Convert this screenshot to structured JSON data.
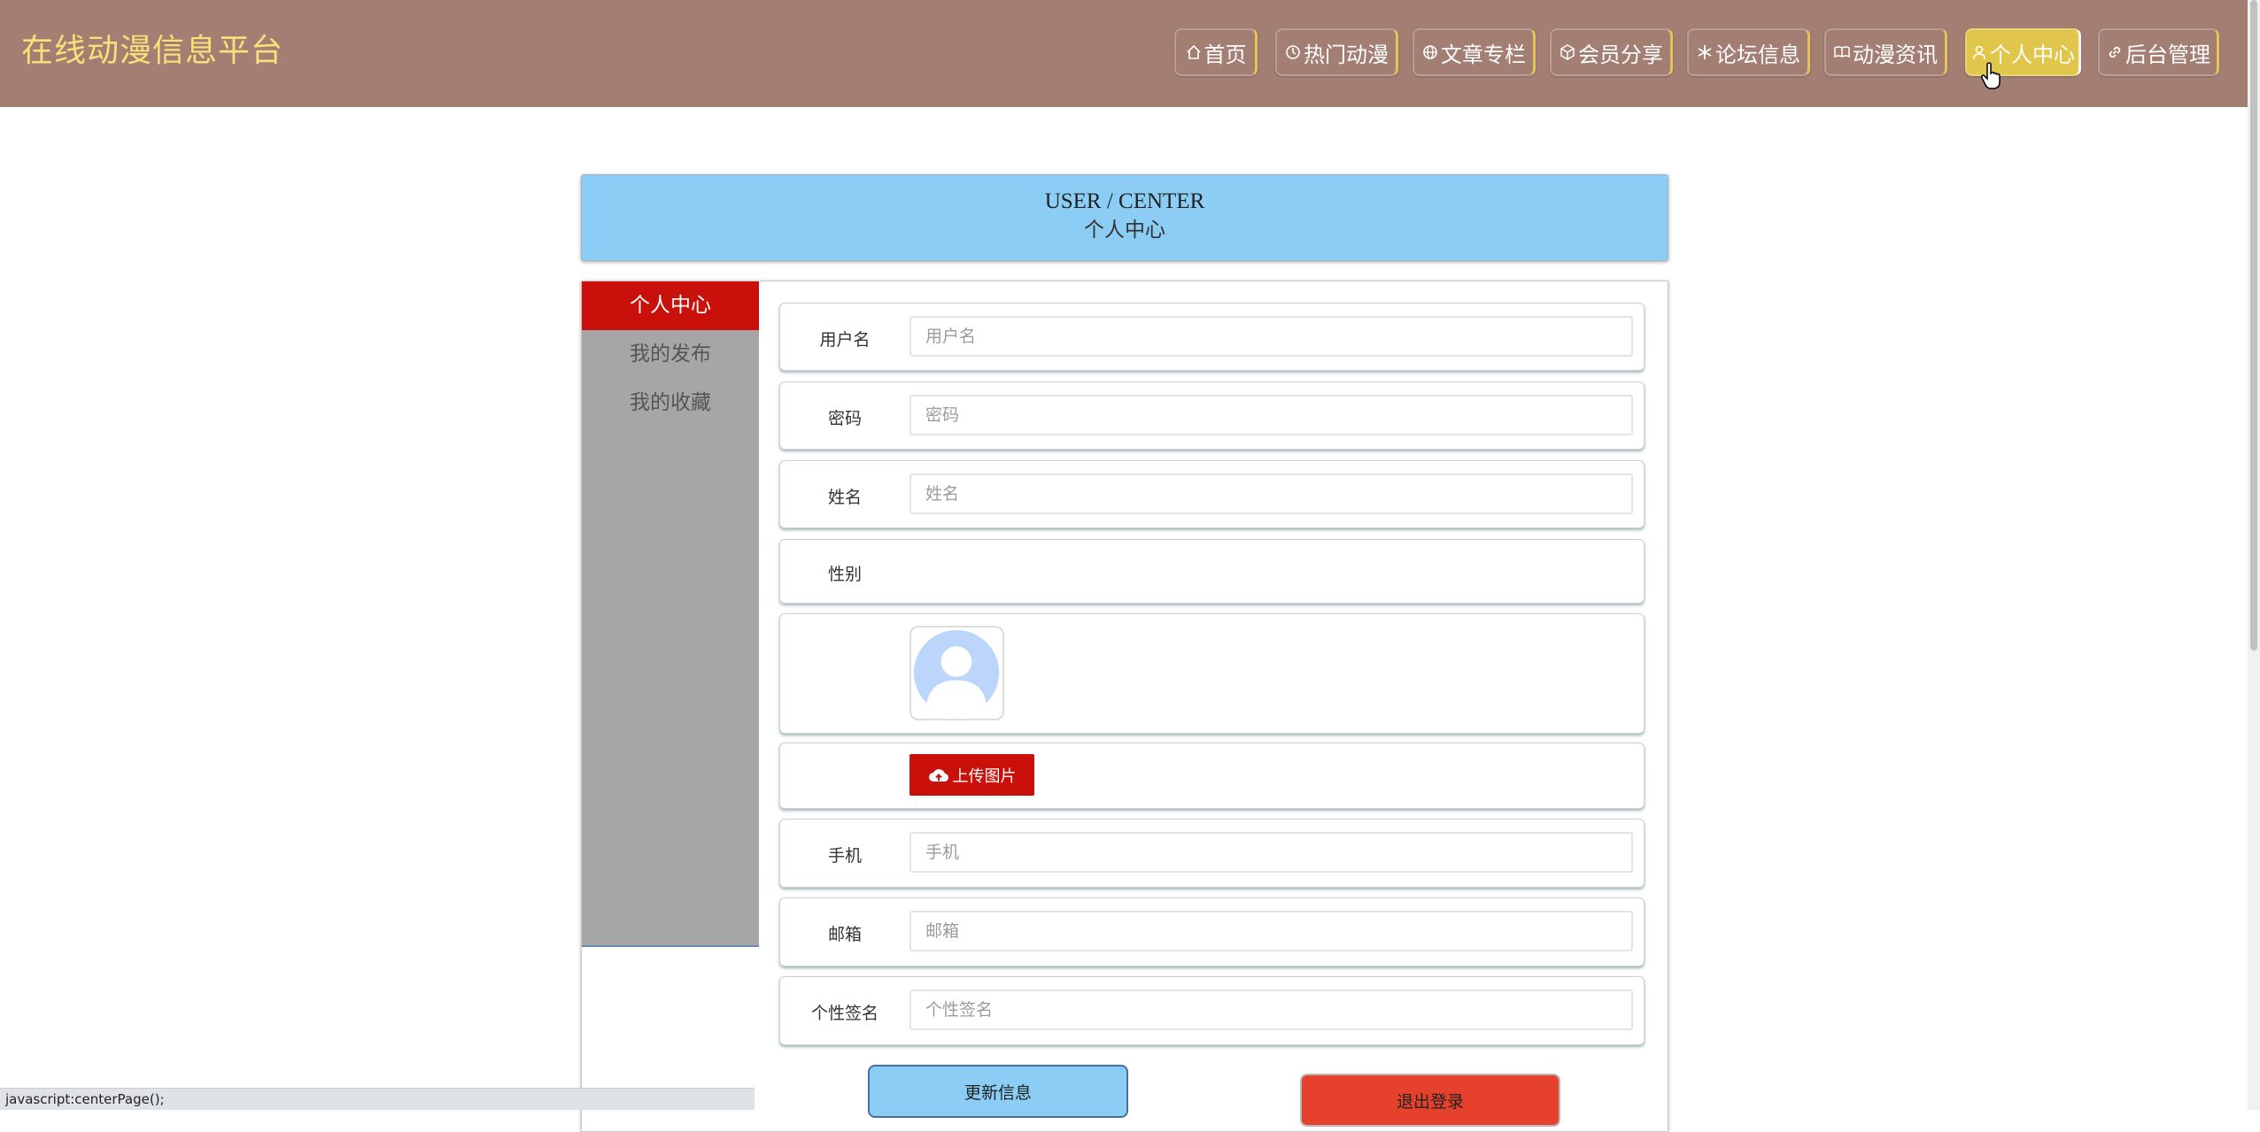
{
  "header": {
    "brand": "在线动漫信息平台",
    "nav": [
      {
        "label": "首页",
        "icon": "home-icon"
      },
      {
        "label": "热门动漫",
        "icon": "clock-icon"
      },
      {
        "label": "文章专栏",
        "icon": "globe-icon"
      },
      {
        "label": "会员分享",
        "icon": "cube-icon"
      },
      {
        "label": "论坛信息",
        "icon": "snowflake-icon"
      },
      {
        "label": "动漫资讯",
        "icon": "book-icon"
      },
      {
        "label": "个人中心",
        "icon": "user-icon",
        "active": true
      },
      {
        "label": "后台管理",
        "icon": "link-icon"
      }
    ]
  },
  "banner": {
    "title_en": "USER / CENTER",
    "title_cn": "个人中心"
  },
  "sidebar": {
    "items": [
      {
        "label": "个人中心",
        "active": true
      },
      {
        "label": "我的发布"
      },
      {
        "label": "我的收藏"
      }
    ]
  },
  "form": {
    "username": {
      "label": "用户名",
      "placeholder": "用户名",
      "value": ""
    },
    "password": {
      "label": "密码",
      "placeholder": "密码",
      "value": ""
    },
    "name": {
      "label": "姓名",
      "placeholder": "姓名",
      "value": ""
    },
    "gender": {
      "label": "性别"
    },
    "upload": {
      "label": "上传图片",
      "icon": "cloud-upload-icon"
    },
    "phone": {
      "label": "手机",
      "placeholder": "手机",
      "value": ""
    },
    "email": {
      "label": "邮箱",
      "placeholder": "邮箱",
      "value": ""
    },
    "signature": {
      "label": "个性签名",
      "placeholder": "个性签名",
      "value": ""
    }
  },
  "actions": {
    "update": "更新信息",
    "logout": "退出登录"
  },
  "status_bar": "javascript:centerPage();",
  "colors": {
    "header_bg": "#a37e72",
    "brand_text": "#f5e07a",
    "active_nav": "#e0c64a",
    "banner_bg": "#8ccdf6",
    "accent_red": "#c9100b",
    "logout_bg": "#e5412c",
    "sidebar_bg": "#a6a6a6"
  }
}
